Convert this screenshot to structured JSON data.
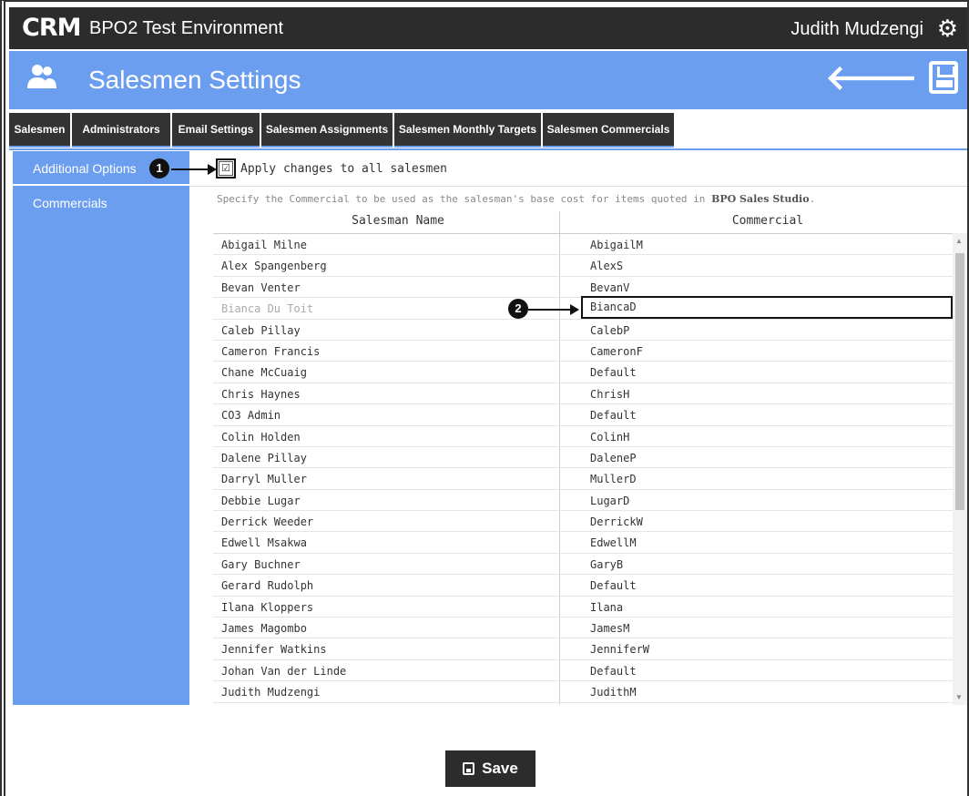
{
  "topbar": {
    "logo": "CRM",
    "environment": "BPO2 Test Environment",
    "user": "Judith Mudzengi",
    "settings_icon": "gear-icon"
  },
  "header": {
    "title": "Salesmen Settings",
    "icon": "users-icon",
    "back_icon": "arrow-left-icon",
    "save_icon": "floppy-disk-icon"
  },
  "tabs": [
    {
      "label": "Salesmen"
    },
    {
      "label": "Administrators"
    },
    {
      "label": "Email Settings"
    },
    {
      "label": "Salesmen Assignments"
    },
    {
      "label": "Salesmen Monthly Targets"
    },
    {
      "label": "Salesmen Commercials",
      "active": true
    }
  ],
  "sidebar": {
    "items": [
      {
        "label": "Additional Options"
      },
      {
        "label": "Commercials"
      }
    ]
  },
  "options": {
    "apply_all_label": "Apply changes to all salesmen",
    "apply_all_checked": true,
    "check_glyph": "☑"
  },
  "description": {
    "text": "Specify the Commercial to be used as the salesman's base cost for items quoted in ",
    "product": "BPO Sales Studio",
    "end": "."
  },
  "table": {
    "headers": [
      "Salesman Name",
      "Commercial"
    ],
    "rows": [
      [
        "Abigail Milne",
        "AbigailM"
      ],
      [
        "Alex Spangenberg",
        "AlexS"
      ],
      [
        "Bevan Venter",
        "BevanV"
      ],
      [
        "Bianca Du Toit",
        "BiancaD"
      ],
      [
        "Caleb Pillay",
        "CalebP"
      ],
      [
        "Cameron Francis",
        "CameronF"
      ],
      [
        "Chane McCuaig",
        "Default"
      ],
      [
        "Chris Haynes",
        "ChrisH"
      ],
      [
        "CO3 Admin",
        "Default"
      ],
      [
        "Colin Holden",
        "ColinH"
      ],
      [
        "Dalene Pillay",
        "DaleneP"
      ],
      [
        "Darryl Muller",
        "MullerD"
      ],
      [
        "Debbie Lugar",
        "LugarD"
      ],
      [
        "Derrick Weeder",
        "DerrickW"
      ],
      [
        "Edwell Msakwa",
        "EdwellM"
      ],
      [
        "Gary Buchner",
        "GaryB"
      ],
      [
        "Gerard Rudolph",
        "Default"
      ],
      [
        "Ilana Kloppers",
        "Ilana"
      ],
      [
        "James Magombo",
        "JamesM"
      ],
      [
        "Jennifer Watkins",
        "JenniferW"
      ],
      [
        "Johan Van der Linde",
        "Default"
      ],
      [
        "Judith Mudzengi",
        "JudithM"
      ]
    ]
  },
  "callouts": [
    "1",
    "2"
  ],
  "save_button": {
    "label": "Save"
  },
  "colors": {
    "accent": "#6c9ef0",
    "dark": "#2c2c2c"
  }
}
